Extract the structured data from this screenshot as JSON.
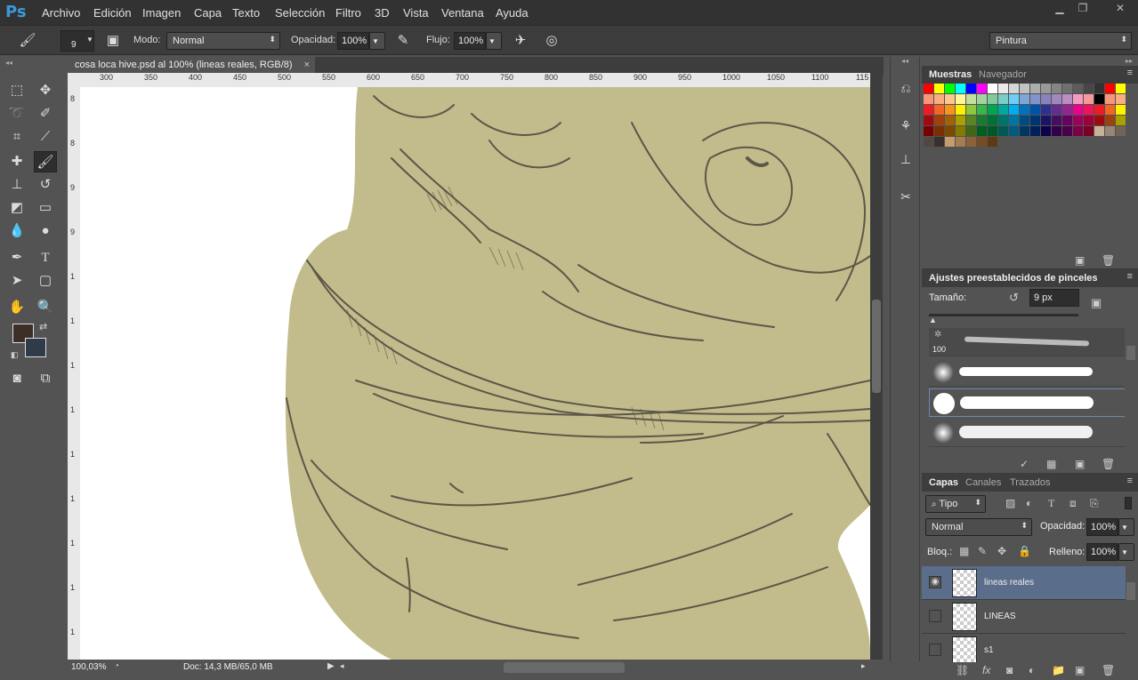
{
  "app": {
    "logo": "Ps"
  },
  "menu": [
    "Archivo",
    "Edición",
    "Imagen",
    "Capa",
    "Texto",
    "Selección",
    "Filtro",
    "3D",
    "Vista",
    "Ventana",
    "Ayuda"
  ],
  "options": {
    "brush_size": "9",
    "mode_label": "Modo:",
    "mode_value": "Normal",
    "opacity_label": "Opacidad:",
    "opacity_value": "100%",
    "flow_label": "Flujo:",
    "flow_value": "100%",
    "workspace": "Pintura"
  },
  "document": {
    "tab_title": "cosa loca hive.psd al 100% (lineas reales, RGB/8)",
    "close": "×",
    "ruler_top": [
      "300",
      "350",
      "400",
      "450",
      "500",
      "550",
      "600",
      "650",
      "700",
      "750",
      "800",
      "850",
      "900",
      "950",
      "1000",
      "1050",
      "1100",
      "115"
    ],
    "ruler_left": [
      "8",
      "8",
      "9",
      "9",
      "1",
      "1",
      "1",
      "1",
      "1",
      "1",
      "1",
      "1",
      "1",
      "1"
    ],
    "zoom": "100,03%",
    "doc_info": "Doc: 14,3 MB/65,0 MB",
    "fill_color": "#c2bc8c",
    "line_color": "#5c5748"
  },
  "swatches_panel": {
    "tabs": [
      "Muestras",
      "Navegador"
    ],
    "colors": [
      "#ff0000",
      "#ffff00",
      "#00ff00",
      "#00ffff",
      "#0000ff",
      "#ff00ff",
      "#ffffff",
      "#ebebeb",
      "#d6d6d6",
      "#c2c2c2",
      "#adadad",
      "#999999",
      "#858585",
      "#707070",
      "#5c5c5c",
      "#474747",
      "#333333",
      "#ff0000",
      "#ffff00",
      "#f7977a",
      "#fbad82",
      "#fdc68c",
      "#fff799",
      "#c4df9b",
      "#a3d39c",
      "#82ca9d",
      "#7bcdc8",
      "#6ecff6",
      "#7ea7d8",
      "#8493ca",
      "#8882be",
      "#a187be",
      "#bc8dbf",
      "#f49ac2",
      "#f6989d",
      "#000000",
      "#f7977a",
      "#fbad82",
      "#ed1c24",
      "#f26522",
      "#f7941d",
      "#fff200",
      "#8dc63f",
      "#39b54a",
      "#00a651",
      "#00a99d",
      "#00aeef",
      "#0072bc",
      "#0054a6",
      "#2e3192",
      "#662d91",
      "#92278f",
      "#ec008c",
      "#ed145b",
      "#ed1c24",
      "#f26522",
      "#fff200",
      "#9e0b0f",
      "#a0410d",
      "#a3620a",
      "#aba000",
      "#598527",
      "#1a7b30",
      "#007236",
      "#00746b",
      "#0076a3",
      "#004b80",
      "#003471",
      "#1b1464",
      "#440e62",
      "#630460",
      "#9e005d",
      "#9e0039",
      "#9e0b0f",
      "#a0410d",
      "#aba000",
      "#790000",
      "#7b2e00",
      "#7d4900",
      "#827b00",
      "#406618",
      "#005e20",
      "#005826",
      "#005952",
      "#005b7f",
      "#003663",
      "#002157",
      "#0d004c",
      "#32004b",
      "#4b0049",
      "#7b0046",
      "#7a0026",
      "#c7b299",
      "#998675",
      "#736357",
      "#534741",
      "#37302d",
      "#c69c6d",
      "#a67c52",
      "#8c6239",
      "#754c24",
      "#603913"
    ]
  },
  "brush_presets_panel": {
    "title": "Ajustes preestablecidos de pinceles",
    "size_label": "Tamaño:",
    "size_value": "9 px",
    "first_count": "100"
  },
  "layers_panel": {
    "tabs": [
      "Capas",
      "Canales",
      "Trazados"
    ],
    "filter": "Tipo",
    "blend": "Normal",
    "opacity_label": "Opacidad:",
    "opacity_value": "100%",
    "lock_label": "Bloq.:",
    "fill_label": "Relleno:",
    "fill_value": "100%",
    "layers": [
      {
        "name": "lineas reales",
        "visible": true,
        "selected": true
      },
      {
        "name": "LINEAS",
        "visible": false,
        "selected": false
      },
      {
        "name": "s1",
        "visible": false,
        "selected": false
      }
    ]
  }
}
